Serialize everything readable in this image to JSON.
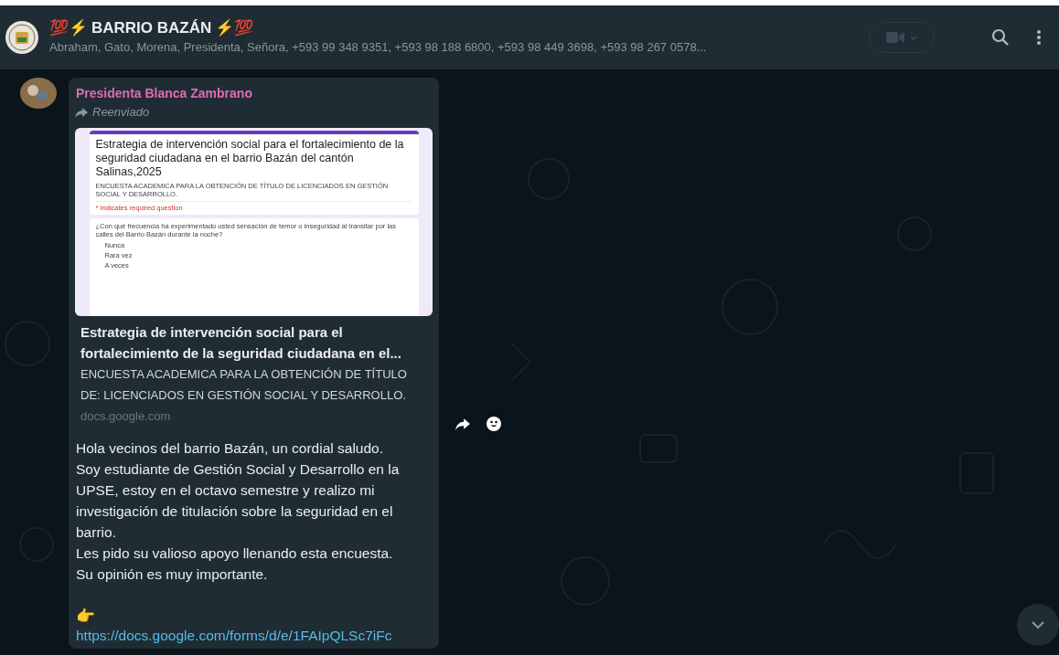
{
  "header": {
    "title_prefix": "💯⚡",
    "title": "BARRIO BAZÁN",
    "title_suffix": "⚡💯",
    "members": "Abraham, Gato, Morena, Presidenta, Señora, +593 99 348 9351, +593 98 188 6800, +593 98 449 3698, +593 98 267 0578..."
  },
  "message": {
    "sender": "Presidenta Blanca Zambrano",
    "forwarded_label": "Reenviado",
    "form_preview": {
      "title": "Estrategia de intervención social para el fortalecimiento de la seguridad ciudadana en el barrio Bazán del cantón Salinas,2025",
      "subtitle": "ENCUESTA ACADEMICA PARA LA OBTENCIÓN DE TÍTULO DE LICENCIADOS EN GESTIÓN SOCIAL Y DESARROLLO.",
      "required_note": "* Indicates required question",
      "question": "¿Con qué frecuencia ha experimentado usted sensación de temor o inseguridad al transitar por las calles del Barrio Bazán durante la noche?",
      "options": [
        "Nunca",
        "Rara vez",
        "A veces"
      ]
    },
    "link_title": "Estrategia de intervención social para el fortalecimiento de la seguridad ciudadana en el...",
    "link_description": "ENCUESTA ACADEMICA PARA LA OBTENCIÓN DE TÍTULO DE: LICENCIADOS EN GESTIÓN SOCIAL Y DESARROLLO.",
    "link_domain": "docs.google.com",
    "body_lines": [
      "Hola vecinos del barrio Bazán, un cordial saludo.",
      "Soy estudiante de Gestión Social y Desarrollo en la UPSE, estoy en el octavo semestre y realizo mi investigación de titulación sobre la seguridad en el barrio.",
      "Les pido su valioso apoyo llenando esta encuesta.",
      "Su opinión es muy importante."
    ],
    "pointer_emoji": "👉",
    "url": "https://docs.google.com/forms/d/e/1FAIpQLSc7iFc"
  }
}
